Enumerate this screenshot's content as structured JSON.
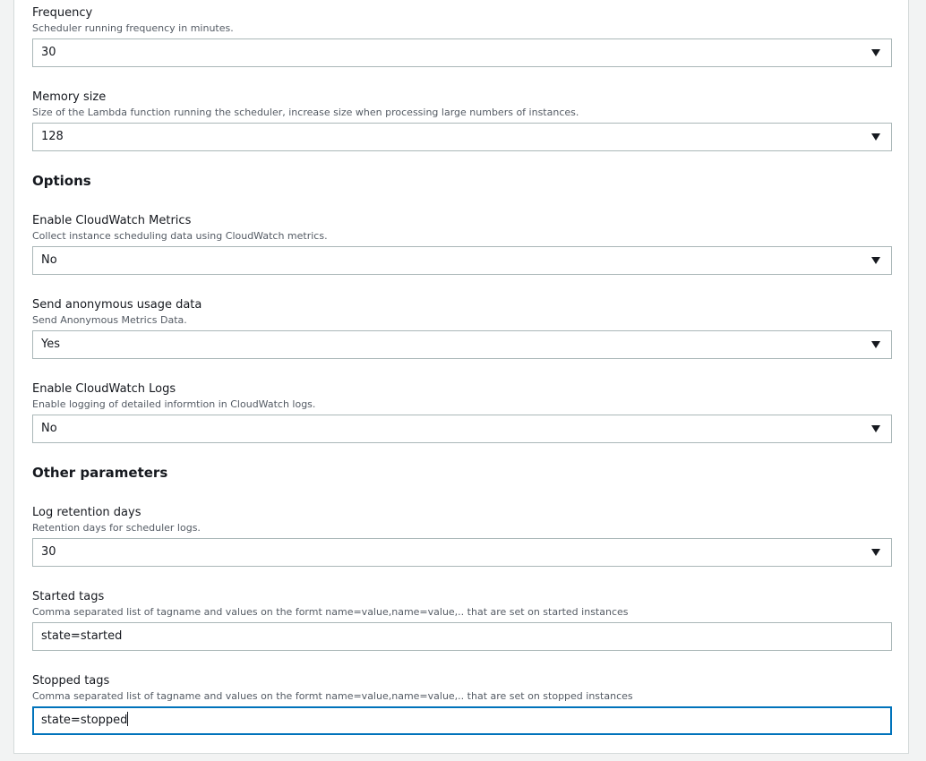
{
  "fields": {
    "frequency": {
      "label": "Frequency",
      "description": "Scheduler running frequency in minutes.",
      "value": "30"
    },
    "memory_size": {
      "label": "Memory size",
      "description": "Size of the Lambda function running the scheduler, increase size when processing large numbers of instances.",
      "value": "128"
    },
    "cloudwatch_metrics": {
      "label": "Enable CloudWatch Metrics",
      "description": "Collect instance scheduling data using CloudWatch metrics.",
      "value": "No"
    },
    "anonymous_usage": {
      "label": "Send anonymous usage data",
      "description": "Send Anonymous Metrics Data.",
      "value": "Yes"
    },
    "cloudwatch_logs": {
      "label": "Enable CloudWatch Logs",
      "description": "Enable logging of detailed informtion in CloudWatch logs.",
      "value": "No"
    },
    "log_retention": {
      "label": "Log retention days",
      "description": "Retention days for scheduler logs.",
      "value": "30"
    },
    "started_tags": {
      "label": "Started tags",
      "description": "Comma separated list of tagname and values on the formt name=value,name=value,.. that are set on started instances",
      "value": "state=started"
    },
    "stopped_tags": {
      "label": "Stopped tags",
      "description": "Comma separated list of tagname and values on the formt name=value,name=value,.. that are set on stopped instances",
      "value": "state=stopped"
    }
  },
  "sections": {
    "options": "Options",
    "other_parameters": "Other parameters"
  },
  "icons": {
    "dropdown": "caret-down-icon"
  },
  "colors": {
    "focus_border": "#0073bb",
    "input_border": "#aab7b8",
    "description_text": "#545b64"
  }
}
